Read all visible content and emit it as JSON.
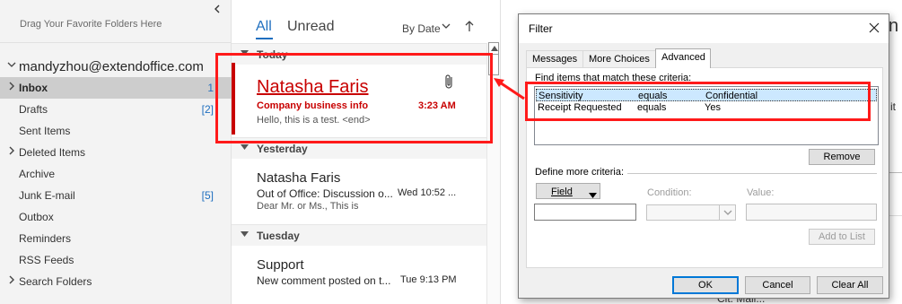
{
  "folder_pane": {
    "favorites_hint": "Drag Your Favorite Folders Here",
    "collapse_icon": "chevron-left-icon",
    "account": "mandyzhou@extendoffice.com",
    "folders": [
      {
        "label": "Inbox",
        "count": "1",
        "expandable": true,
        "selected": true
      },
      {
        "label": "Drafts",
        "count": "[2]",
        "expandable": false
      },
      {
        "label": "Sent Items",
        "count": "",
        "expandable": false
      },
      {
        "label": "Deleted Items",
        "count": "",
        "expandable": true
      },
      {
        "label": "Archive",
        "count": "",
        "expandable": false
      },
      {
        "label": "Junk E-mail",
        "count": "[5]",
        "expandable": false
      },
      {
        "label": "Outbox",
        "count": "",
        "expandable": false
      },
      {
        "label": "Reminders",
        "count": "",
        "expandable": false
      },
      {
        "label": "RSS Feeds",
        "count": "",
        "expandable": false
      },
      {
        "label": "Search Folders",
        "count": "",
        "expandable": true
      }
    ]
  },
  "message_list": {
    "tabs": {
      "all": "All",
      "unread": "Unread"
    },
    "sort": {
      "label": "By Date",
      "direction_icon": "arrow-up-icon"
    },
    "groups": {
      "today": "Today",
      "yesterday": "Yesterday",
      "tuesday": "Tuesday"
    },
    "messages": [
      {
        "sender": "Natasha Faris",
        "subject": "Company business info",
        "time": "3:23 AM",
        "preview": "Hello, this is a test. <end>",
        "attachment": true,
        "color": "#c80000"
      },
      {
        "sender": "Natasha Faris",
        "subject": "Out of Office: Discussion o...",
        "time": "Wed 10:52 ...",
        "preview": "Dear Mr. or Ms.,   This is"
      },
      {
        "sender": "Support",
        "subject": "New comment posted on t...",
        "time": "Tue 9:13 PM",
        "preview": ""
      }
    ]
  },
  "reading_pane": {
    "fragment_title": "n",
    "fragment_side": "it",
    "fragment_bottom": "Cit. Mail..."
  },
  "filter_dialog": {
    "title": "Filter",
    "tabs": [
      "Messages",
      "More Choices",
      "Advanced"
    ],
    "active_tab": "Advanced",
    "find_label": "Find items that match these criteria:",
    "criteria": [
      {
        "field": "Sensitivity",
        "condition": "equals",
        "value": "Confidential"
      },
      {
        "field": "Receipt Requested",
        "condition": "equals",
        "value": "Yes"
      }
    ],
    "remove_label": "Remove",
    "define_label": "Define more criteria:",
    "field_label": "Field",
    "condition_label": "Condition:",
    "value_label": "Value:",
    "add_to_list_label": "Add to List",
    "ok_label": "OK",
    "cancel_label": "Cancel",
    "clear_all_label": "Clear All"
  },
  "annotation_color": "#ff1a1a"
}
